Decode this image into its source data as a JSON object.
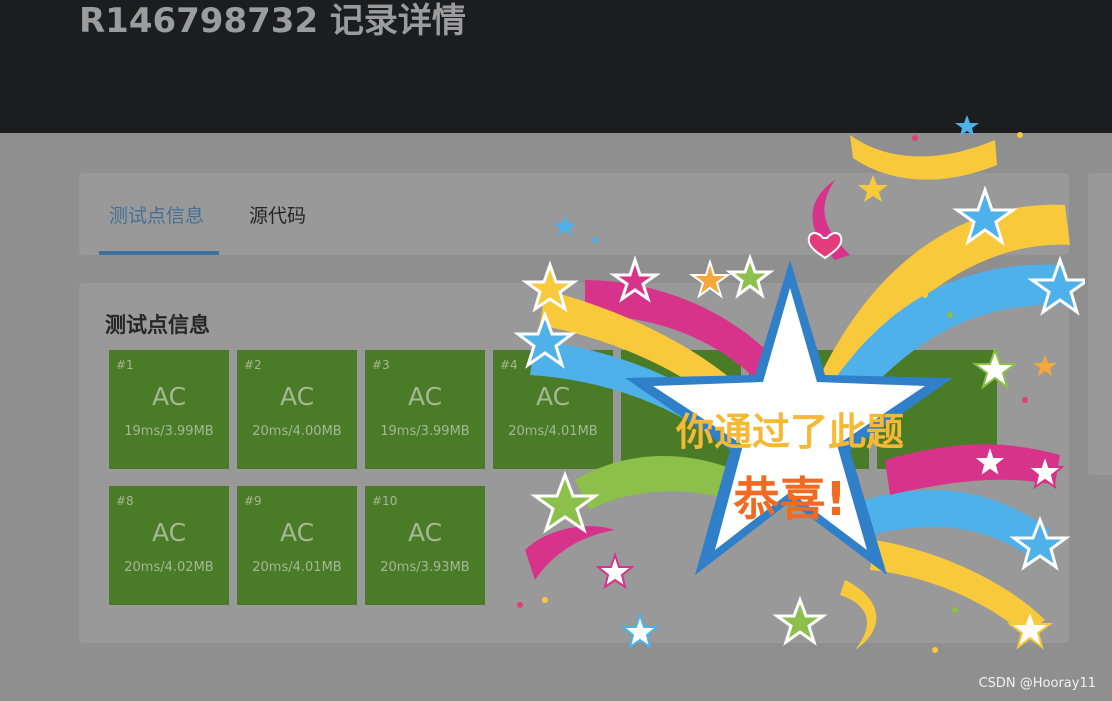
{
  "header": {
    "title": "R146798732 记录详情"
  },
  "tabs": [
    {
      "label": "测试点信息",
      "active": true
    },
    {
      "label": "源代码",
      "active": false
    }
  ],
  "section": {
    "title": "测试点信息"
  },
  "testcases": [
    {
      "num": "#1",
      "status": "AC",
      "stat": "19ms/3.99MB"
    },
    {
      "num": "#2",
      "status": "AC",
      "stat": "20ms/4.00MB"
    },
    {
      "num": "#3",
      "status": "AC",
      "stat": "19ms/3.99MB"
    },
    {
      "num": "#4",
      "status": "AC",
      "stat": "20ms/4.01MB"
    },
    {
      "num": "#8",
      "status": "AC",
      "stat": "20ms/4.02MB"
    },
    {
      "num": "#9",
      "status": "AC",
      "stat": "20ms/4.01MB"
    },
    {
      "num": "#10",
      "status": "AC",
      "stat": "20ms/3.93MB"
    }
  ],
  "popup": {
    "line1": "你通过了此题",
    "line2": "恭喜!"
  },
  "watermark": "CSDN @Hooray11",
  "colors": {
    "accept_green": "#4a7b27",
    "tab_active": "#466f96",
    "star_blue": "#2f7fc9",
    "ribbon_yellow": "#f8c93a",
    "ribbon_pink": "#d8338b",
    "ribbon_sky": "#4eb1ea",
    "text_gold": "#f5b935",
    "text_orange": "#f06a22"
  },
  "icons": [
    "star-icon",
    "heart-icon"
  ]
}
